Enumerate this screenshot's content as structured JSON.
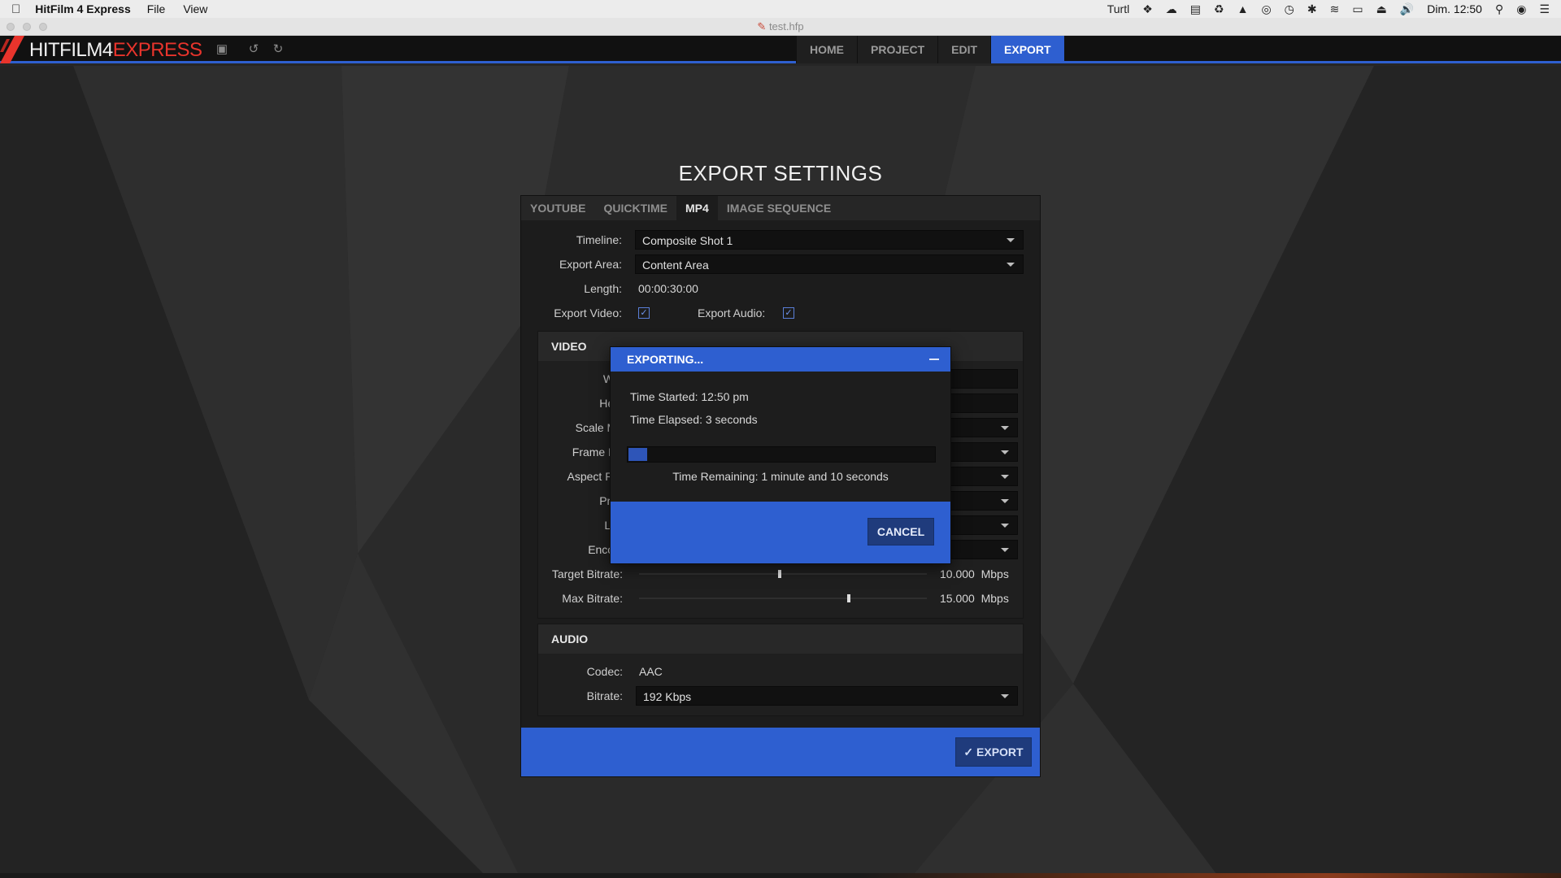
{
  "menubar": {
    "app_name": "HitFilm 4 Express",
    "menus": [
      "File",
      "View"
    ],
    "status_user": "Turtl",
    "clock": "Dim. 12:50"
  },
  "window": {
    "title": "test.hfp"
  },
  "appbar": {
    "brand_main": "HITFILM4",
    "brand_accent": "EXPRESS",
    "nav_tabs": [
      "HOME",
      "PROJECT",
      "EDIT",
      "EXPORT"
    ],
    "active_tab": "EXPORT"
  },
  "export_settings": {
    "heading": "EXPORT SETTINGS",
    "format_tabs": [
      "YOUTUBE",
      "QUICKTIME",
      "MP4",
      "IMAGE SEQUENCE"
    ],
    "active_format": "MP4",
    "timeline": {
      "label": "Timeline:",
      "value": "Composite Shot 1"
    },
    "export_area": {
      "label": "Export Area:",
      "value": "Content Area"
    },
    "length": {
      "label": "Length:",
      "value": "00:00:30:00"
    },
    "export_video": {
      "label": "Export Video:",
      "checked": true
    },
    "export_audio": {
      "label": "Export Audio:",
      "checked": true
    },
    "video": {
      "title": "VIDEO",
      "labels": [
        "Wid",
        "Heig",
        "Scale Mo",
        "Frame Ra",
        "Aspect Rat",
        "Profi",
        "Lev",
        "Encodi"
      ],
      "target_bitrate": {
        "label": "Target Bitrate:",
        "value": "10.000",
        "unit": "Mbps",
        "slider_fraction": 0.49
      },
      "max_bitrate": {
        "label": "Max Bitrate:",
        "value": "15.000",
        "unit": "Mbps",
        "slider_fraction": 0.73
      }
    },
    "audio": {
      "title": "AUDIO",
      "codec": {
        "label": "Codec:",
        "value": "AAC"
      },
      "bitrate": {
        "label": "Bitrate:",
        "value": "192 Kbps"
      }
    },
    "export_button": "EXPORT"
  },
  "dialog": {
    "title": "EXPORTING...",
    "time_started": "Time Started: 12:50 pm",
    "time_elapsed": "Time Elapsed: 3 seconds",
    "progress_fraction": 0.06,
    "time_remaining": "Time Remaining: 1 minute and 10 seconds",
    "cancel_button": "CANCEL"
  },
  "colors": {
    "accent": "#2e5fd0",
    "brand_red": "#e8342c"
  },
  "icons": [
    "apple-icon",
    "save-icon",
    "undo-icon",
    "redo-icon",
    "checkmark-icon",
    "minimize-icon",
    "dropdown-arrow-icon"
  ]
}
